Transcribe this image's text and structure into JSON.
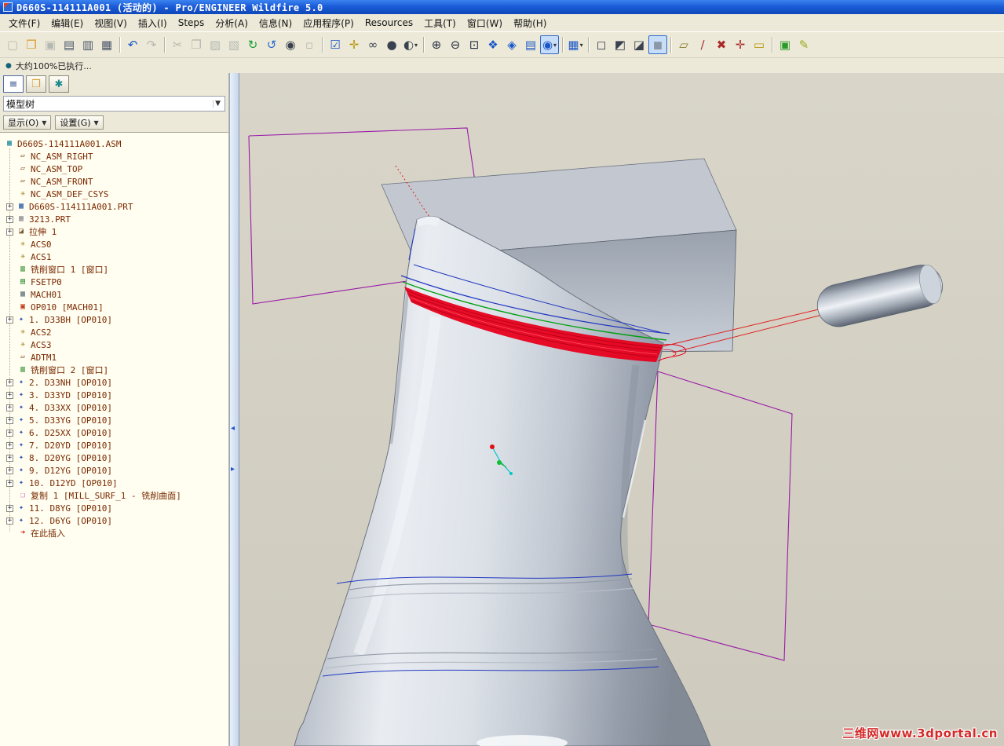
{
  "window": {
    "title": "D660S-114111A001 (活动的) - Pro/ENGINEER Wildfire 5.0"
  },
  "menu": {
    "items": [
      {
        "name": "file",
        "label": "文件(F)"
      },
      {
        "name": "edit",
        "label": "编辑(E)"
      },
      {
        "name": "view",
        "label": "视图(V)"
      },
      {
        "name": "insert",
        "label": "插入(I)"
      },
      {
        "name": "steps",
        "label": "Steps"
      },
      {
        "name": "analysis",
        "label": "分析(A)"
      },
      {
        "name": "info",
        "label": "信息(N)"
      },
      {
        "name": "applications",
        "label": "应用程序(P)"
      },
      {
        "name": "resources",
        "label": "Resources"
      },
      {
        "name": "tools",
        "label": "工具(T)"
      },
      {
        "name": "window",
        "label": "窗口(W)"
      },
      {
        "name": "help",
        "label": "帮助(H)"
      }
    ]
  },
  "toolbar": {
    "groups": [
      {
        "items": [
          {
            "name": "new-file",
            "glyph": "▢",
            "color": "#9aa0a6",
            "disabled": true
          },
          {
            "name": "open-file",
            "glyph": "❒",
            "color": "#d79b2a"
          },
          {
            "name": "save-file",
            "glyph": "▣",
            "color": "#9aa0a6",
            "disabled": true
          },
          {
            "name": "print",
            "glyph": "▤",
            "color": "#4a5568"
          },
          {
            "name": "print-preview",
            "glyph": "▥",
            "color": "#4a5568"
          },
          {
            "name": "print-setup",
            "glyph": "▦",
            "color": "#4a5568"
          }
        ]
      },
      {
        "items": [
          {
            "name": "undo",
            "glyph": "↶",
            "color": "#1a57c8"
          },
          {
            "name": "redo",
            "glyph": "↷",
            "color": "#a8b0b8",
            "disabled": true
          }
        ]
      },
      {
        "items": [
          {
            "name": "cut",
            "glyph": "✂",
            "color": "#9aa0a6",
            "disabled": true
          },
          {
            "name": "copy",
            "glyph": "❐",
            "color": "#9aa0a6",
            "disabled": true
          },
          {
            "name": "paste",
            "glyph": "▨",
            "color": "#9aa0a6",
            "disabled": true
          },
          {
            "name": "paste-special",
            "glyph": "▧",
            "color": "#9aa0a6",
            "disabled": true
          },
          {
            "name": "regenerate",
            "glyph": "↻",
            "color": "#18a038"
          },
          {
            "name": "custom-regenerate",
            "glyph": "↺",
            "color": "#2a6ad0"
          },
          {
            "name": "find",
            "glyph": "◉",
            "color": "#3a4250"
          },
          {
            "name": "select-by-box",
            "glyph": "▫",
            "color": "#9aa0a6",
            "disabled": true
          }
        ]
      },
      {
        "items": [
          {
            "name": "smart-select-filter",
            "glyph": "☑",
            "color": "#1a57c8"
          },
          {
            "name": "datum-point-tool",
            "glyph": "✛",
            "color": "#b8960a"
          },
          {
            "name": "visibility-glasses",
            "glyph": "∞",
            "color": "#3a4250"
          },
          {
            "name": "appearance-sphere",
            "glyph": "●",
            "color": "#3a4250"
          },
          {
            "name": "appearance-gallery",
            "glyph": "◐",
            "color": "#3a4250",
            "dropdown": true
          }
        ]
      },
      {
        "items": [
          {
            "name": "zoom-in",
            "glyph": "⊕",
            "color": "#2a3240"
          },
          {
            "name": "zoom-out",
            "glyph": "⊖",
            "color": "#2a3240"
          },
          {
            "name": "refit",
            "glyph": "⊡",
            "color": "#2a3240"
          },
          {
            "name": "repaint",
            "glyph": "❖",
            "color": "#1a57c8"
          },
          {
            "name": "saved-orientations",
            "glyph": "◈",
            "color": "#1a57c8"
          },
          {
            "name": "layers",
            "glyph": "▤",
            "color": "#1a57c8"
          },
          {
            "name": "spin-center",
            "glyph": "◉",
            "color": "#1a57c8",
            "active": true,
            "dropdown": true
          }
        ]
      },
      {
        "items": [
          {
            "name": "view-manager",
            "glyph": "▦",
            "color": "#1a57c8",
            "dropdown": true
          }
        ]
      },
      {
        "items": [
          {
            "name": "wireframe-display",
            "glyph": "◻",
            "color": "#3a4250"
          },
          {
            "name": "hidden-line-display",
            "glyph": "◩",
            "color": "#3a4250"
          },
          {
            "name": "no-hidden-display",
            "glyph": "◪",
            "color": "#3a4250"
          },
          {
            "name": "shaded-display",
            "glyph": "◼",
            "color": "#8a98a8",
            "active": true
          }
        ]
      },
      {
        "items": [
          {
            "name": "datum-plane-display",
            "glyph": "▱",
            "color": "#8a7a2a"
          },
          {
            "name": "datum-axis-display",
            "glyph": "∕",
            "color": "#aa2a2a"
          },
          {
            "name": "point-display",
            "glyph": "✖",
            "color": "#aa2a2a"
          },
          {
            "name": "csys-display",
            "glyph": "✛",
            "color": "#aa2a2a"
          },
          {
            "name": "annotation-display",
            "glyph": "▭",
            "color": "#b8960a"
          }
        ]
      },
      {
        "items": [
          {
            "name": "activate-window",
            "glyph": "▣",
            "color": "#2a9a2a"
          },
          {
            "name": "edit-mode",
            "glyph": "✎",
            "color": "#98a81a"
          }
        ]
      }
    ]
  },
  "status": {
    "bullet": "●",
    "message": "大约100%已执行..."
  },
  "tree_panel": {
    "tabs": [
      {
        "name": "model-tree-tab",
        "glyph": "≡",
        "color": "#2a4a8a",
        "active": true
      },
      {
        "name": "folder-browser-tab",
        "glyph": "❒",
        "color": "#d79b2a",
        "active": false
      },
      {
        "name": "favorites-tab",
        "glyph": "✱",
        "color": "#1a8a8a",
        "active": false
      }
    ],
    "title": "模型树",
    "title_caret": "▼",
    "buttons": [
      {
        "name": "show-menu-button",
        "label": "显示(O)",
        "caret": "▼"
      },
      {
        "name": "settings-menu-button",
        "label": "设置(G)",
        "caret": "▼"
      }
    ],
    "icon_glyphs": {
      "asm": {
        "g": "▦",
        "c": "#1a8a9a"
      },
      "datum-plane": {
        "g": "▱",
        "c": "#8a5a2a"
      },
      "csys": {
        "g": "✳",
        "c": "#a07a10"
      },
      "part": {
        "g": "▦",
        "c": "#2a5aaa"
      },
      "part-gray": {
        "g": "▦",
        "c": "#8a8a92"
      },
      "extrude": {
        "g": "◪",
        "c": "#7a5a3a"
      },
      "mill-window": {
        "g": "▥",
        "c": "#2a8a2a"
      },
      "fixture-setup": {
        "g": "▤",
        "c": "#2a8a2a"
      },
      "machine": {
        "g": "▦",
        "c": "#66707e"
      },
      "operation": {
        "g": "▣",
        "c": "#c03a1a"
      },
      "nc-step": {
        "g": "✦",
        "c": "#2a4ab0"
      },
      "copy-feature": {
        "g": "❏",
        "c": "#d060b0"
      },
      "insert-here": {
        "g": "➜",
        "c": "#d81010"
      }
    },
    "items": [
      {
        "root": true,
        "icon": "asm",
        "label": "D660S-114111A001.ASM"
      },
      {
        "icon": "datum-plane",
        "label": "NC_ASM_RIGHT"
      },
      {
        "icon": "datum-plane",
        "label": "NC_ASM_TOP"
      },
      {
        "icon": "datum-plane",
        "label": "NC_ASM_FRONT"
      },
      {
        "icon": "csys",
        "label": "NC_ASM_DEF_CSYS"
      },
      {
        "plus": true,
        "icon": "part",
        "label": "D660S-114111A001.PRT"
      },
      {
        "plus": true,
        "icon": "part-gray",
        "label": "3213.PRT"
      },
      {
        "plus": true,
        "icon": "extrude",
        "label": "拉伸 1"
      },
      {
        "icon": "csys",
        "label": "ACS0"
      },
      {
        "icon": "csys",
        "label": "ACS1"
      },
      {
        "icon": "mill-window",
        "label": "铣削窗口 1 [窗口]"
      },
      {
        "icon": "fixture-setup",
        "label": "FSETP0"
      },
      {
        "icon": "machine",
        "label": "MACH01"
      },
      {
        "icon": "operation",
        "label": "OP010 [MACH01]"
      },
      {
        "plus": true,
        "icon": "nc-step",
        "label": "1. D33BH [OP010]"
      },
      {
        "icon": "csys",
        "label": "ACS2"
      },
      {
        "icon": "csys",
        "label": "ACS3"
      },
      {
        "icon": "datum-plane",
        "label": "ADTM1"
      },
      {
        "icon": "mill-window",
        "label": "铣削窗口 2 [窗口]"
      },
      {
        "plus": true,
        "icon": "nc-step",
        "label": "2. D33NH [OP010]"
      },
      {
        "plus": true,
        "icon": "nc-step",
        "label": "3. D33YD [OP010]"
      },
      {
        "plus": true,
        "icon": "nc-step",
        "label": "4. D33XX [OP010]"
      },
      {
        "plus": true,
        "icon": "nc-step",
        "label": "5. D33YG [OP010]"
      },
      {
        "plus": true,
        "icon": "nc-step",
        "label": "6. D25XX [OP010]"
      },
      {
        "plus": true,
        "icon": "nc-step",
        "label": "7. D20YD [OP010]"
      },
      {
        "plus": true,
        "icon": "nc-step",
        "label": "8. D20YG [OP010]"
      },
      {
        "plus": true,
        "icon": "nc-step",
        "label": "9. D12YG [OP010]"
      },
      {
        "plus": true,
        "icon": "nc-step",
        "label": "10. D12YD [OP010]"
      },
      {
        "icon": "copy-feature",
        "label": "复制 1 [MILL_SURF_1 - 铣削曲面]"
      },
      {
        "plus": true,
        "icon": "nc-step",
        "label": "11. D8YG [OP010]"
      },
      {
        "plus": true,
        "icon": "nc-step",
        "label": "12. D6YG [OP010]"
      },
      {
        "icon": "insert-here",
        "label": "在此插入"
      }
    ]
  },
  "splitter": {
    "collapse_glyph": "◂",
    "expand_glyph": "▸"
  },
  "viewport": {
    "watermark": "三维网www.3dportal.cn"
  }
}
